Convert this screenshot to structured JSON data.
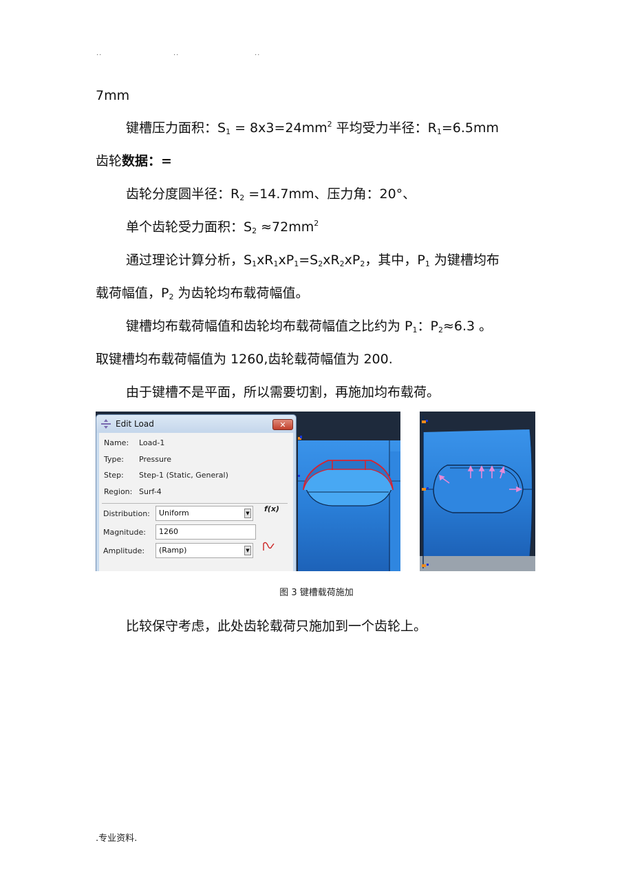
{
  "header": {
    "dots": [
      "..",
      "..",
      ".."
    ]
  },
  "body": {
    "line1": "7mm",
    "line2": {
      "label": "键槽压力面积：S",
      "sub1": "1",
      "mid": " =  8x3=24mm",
      "sup1": "2",
      "label2": "  平均受力半径：R",
      "sub2": "1",
      "end": "=6.5mm"
    },
    "line3": {
      "a": "齿轮",
      "b": "数据：="
    },
    "line4": {
      "a": "齿轮分度圆半径：R",
      "sub": "2",
      "b": " =14.7mm、压力角：20°、"
    },
    "line5": {
      "a": "单个齿轮受力面积：S",
      "sub": "2",
      "b": " ≈72mm",
      "sup": "2"
    },
    "line6": {
      "a": "通过理论计算分析，S",
      "s1": "1",
      "b": "xR",
      "s2": "1",
      "c": "xP",
      "s3": "1",
      "d": "=S",
      "s4": "2",
      "e": "xR",
      "s5": "2",
      "f": "xP",
      "s6": "2",
      "g": "，其中，P",
      "s7": "1",
      "h": " 为键槽均布"
    },
    "line7": {
      "a": "载荷幅值，P",
      "sub": "2",
      "b": " 为齿轮均布载荷幅值。"
    },
    "line8": {
      "a": "键槽均布载荷幅值和齿轮均布载荷幅值之比约为 P",
      "s1": "1",
      "b": "：P",
      "s2": "2",
      "c": "≈6.3  。"
    },
    "line9": "取键槽均布载荷幅值为 1260,齿轮载荷幅值为 200.",
    "line10": "由于键槽不是平面，所以需要切割，再施加均布载荷。",
    "line11": "比较保守考虑，此处齿轮载荷只施加到一个齿轮上。"
  },
  "figure": {
    "caption": "图 3  键槽载荷施加",
    "dialog": {
      "title": "Edit Load",
      "close": "✕",
      "name_label": "Name:",
      "name_value": "Load-1",
      "type_label": "Type:",
      "type_value": "Pressure",
      "step_label": "Step:",
      "step_value": "Step-1 (Static, General)",
      "region_label": "Region:",
      "region_value": "Surf-4",
      "distribution_label": "Distribution:",
      "distribution_value": "Uniform",
      "magnitude_label": "Magnitude:",
      "magnitude_value": "1260",
      "amplitude_label": "Amplitude:",
      "amplitude_value": "(Ramp)",
      "fx_label": "f(x)",
      "dropdown_glyph": "▼"
    },
    "colors": {
      "part_blue": "#2f86e0",
      "edge_red": "#d8232f",
      "arrow_pink": "#e58ad8",
      "bg_dark": "#1e2a3c"
    }
  },
  "footer": ".专业资料."
}
